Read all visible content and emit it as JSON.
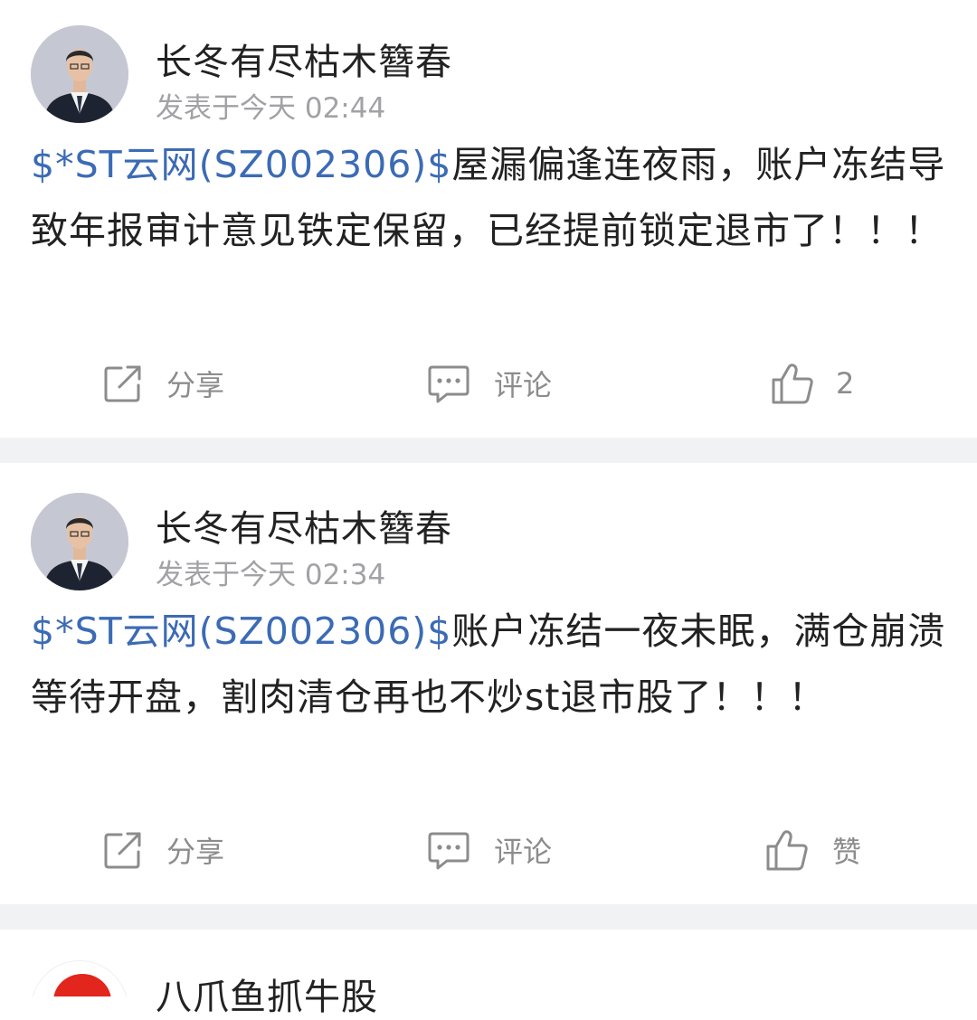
{
  "posts": [
    {
      "author": "长冬有尽枯木簪春",
      "time": "发表于今天 02:44",
      "stock_tag": "$*ST云网(SZ002306)$",
      "text": "屋漏偏逢连夜雨，账户冻结导致年报审计意见铁定保留，已经提前锁定退市了！！！",
      "share_label": "分享",
      "comment_label": "评论",
      "like_label": "2"
    },
    {
      "author": "长冬有尽枯木簪春",
      "time": "发表于今天 02:34",
      "stock_tag": "$*ST云网(SZ002306)$",
      "text": "账户冻结一夜未眠，满仓崩溃等待开盘，割肉清仓再也不炒st退市股了！！！",
      "share_label": "分享",
      "comment_label": "评论",
      "like_label": "赞"
    },
    {
      "author": "八爪鱼抓牛股"
    }
  ],
  "icons": {
    "share": "share-icon",
    "comment": "comment-icon",
    "like": "thumbs-up-icon"
  },
  "colors": {
    "stock_link": "#3b6bb5",
    "text": "#222222",
    "meta": "#a2a2a6",
    "action": "#8c8c8c",
    "separator": "#f1f2f4"
  }
}
